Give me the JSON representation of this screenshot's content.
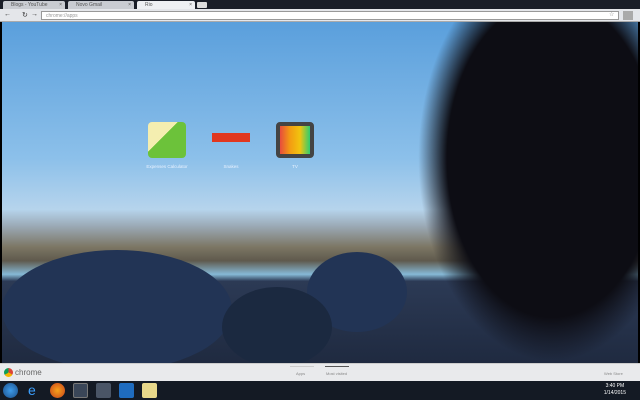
{
  "browser": {
    "tabs": [
      {
        "label": "Blogs - YouTube"
      },
      {
        "label": "Novo Gmail"
      },
      {
        "label": "Rio"
      }
    ],
    "url": "chrome://apps",
    "back_icon": "back-arrow",
    "reload_icon": "reload"
  },
  "apps": [
    {
      "label": "Expenses Calculator",
      "icon": "ledger-folder"
    },
    {
      "label": "Snakes",
      "icon": "snakes-logo"
    },
    {
      "label": "TV",
      "icon": "retro-tv"
    }
  ],
  "bottom_bar": {
    "brand": "chrome",
    "pages": [
      "Apps",
      "Most visited"
    ],
    "web_store": "Web Store"
  },
  "taskbar": {
    "time": "3:40 PM",
    "date": "1/14/2015"
  }
}
